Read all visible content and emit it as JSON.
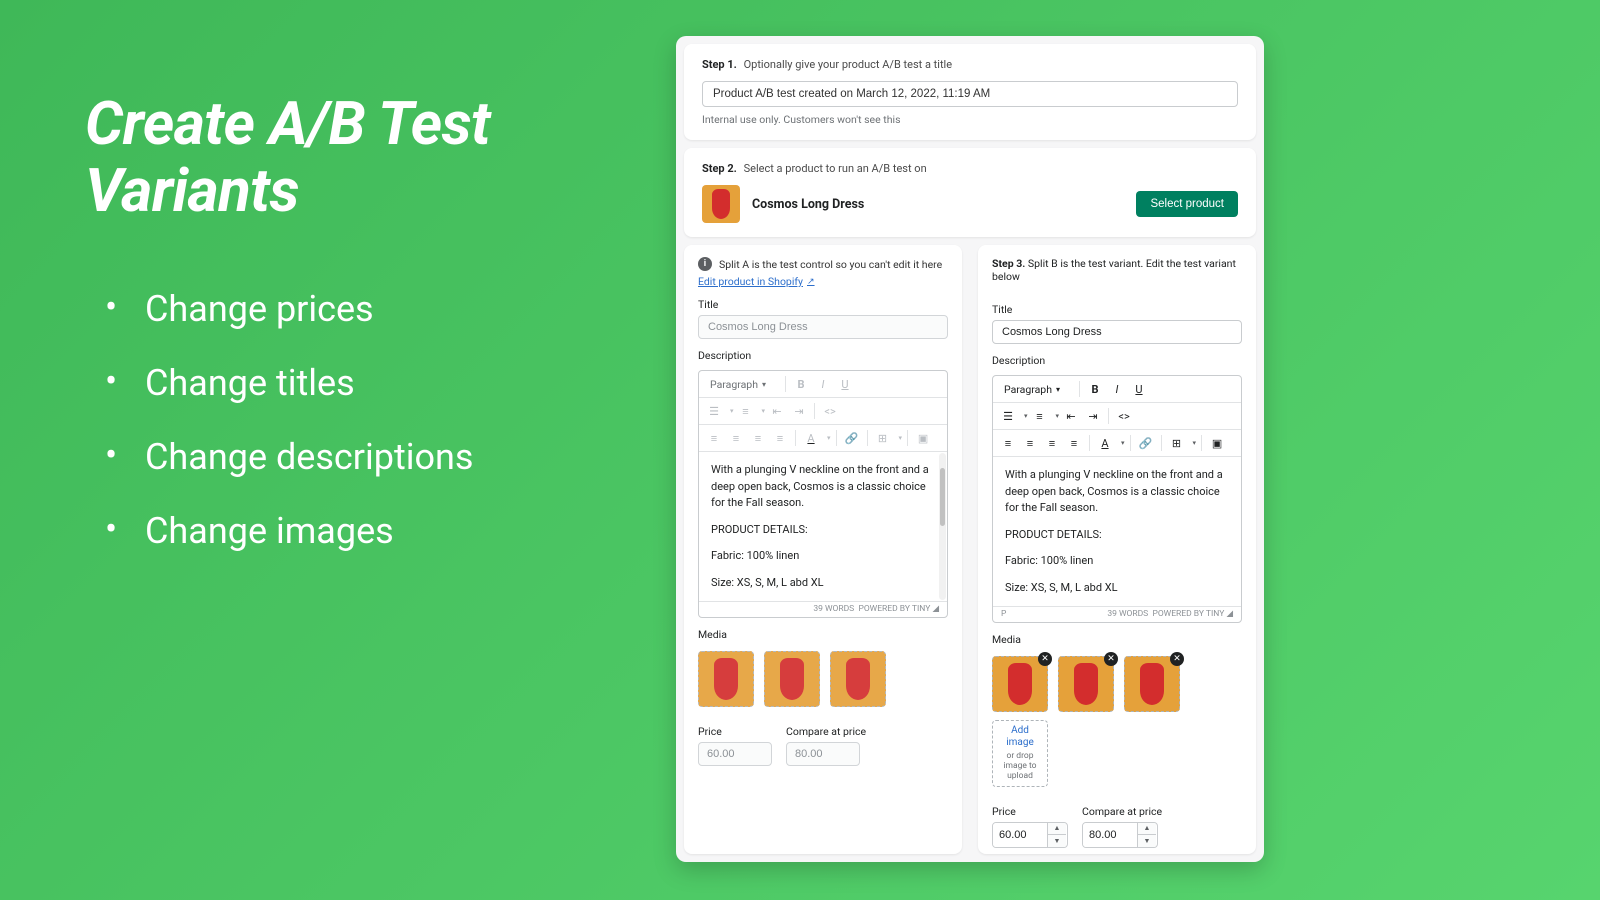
{
  "left": {
    "title_line1": "Create A/B Test",
    "title_line2": "Variants",
    "bullets": [
      "Change prices",
      "Change titles",
      "Change descriptions",
      "Change images"
    ]
  },
  "step1": {
    "label": "Step 1.",
    "desc": "Optionally give your product A/B test a title",
    "value": "Product A/B test created on March 12, 2022, 11:19 AM",
    "help": "Internal use only. Customers won't see this"
  },
  "step2": {
    "label": "Step 2.",
    "desc": "Select a product to run an A/B test on",
    "product": "Cosmos Long Dress",
    "button": "Select product"
  },
  "splitA": {
    "info": "Split A is the test control so you can't edit it here",
    "link": "Edit product in Shopify",
    "title_label": "Title",
    "title_value": "Cosmos Long Dress",
    "description_label": "Description",
    "paragraph_option": "Paragraph",
    "body_line1": "With a plunging V neckline on the front and a deep open back, Cosmos is a classic choice for the Fall season.",
    "body_line2": "PRODUCT DETAILS:",
    "body_line3": "Fabric: 100% linen",
    "body_line4": "Size: XS, S, M, L abd XL",
    "footer_words": "39 WORDS",
    "footer_tiny": "POWERED BY TINY",
    "media_label": "Media",
    "price_label": "Price",
    "price_value": "60.00",
    "compare_label": "Compare at price",
    "compare_value": "80.00"
  },
  "splitB": {
    "step_label": "Step 3.",
    "step_desc": "Split B is the test variant. Edit the test variant below",
    "title_label": "Title",
    "title_value": "Cosmos Long Dress",
    "description_label": "Description",
    "paragraph_option": "Paragraph",
    "body_line1": "With a plunging V neckline on the front and a deep open back, Cosmos is a classic choice for the Fall season.",
    "body_line2": "PRODUCT DETAILS:",
    "body_line3": "Fabric: 100% linen",
    "body_line4": "Size: XS, S, M, L abd XL",
    "footer_p": "P",
    "footer_words": "39 WORDS",
    "footer_tiny": "POWERED BY TINY",
    "media_label": "Media",
    "add_image": "Add image",
    "drop_text": "or drop image to upload",
    "price_label": "Price",
    "price_value": "60.00",
    "compare_label": "Compare at price",
    "compare_value": "80.00"
  }
}
